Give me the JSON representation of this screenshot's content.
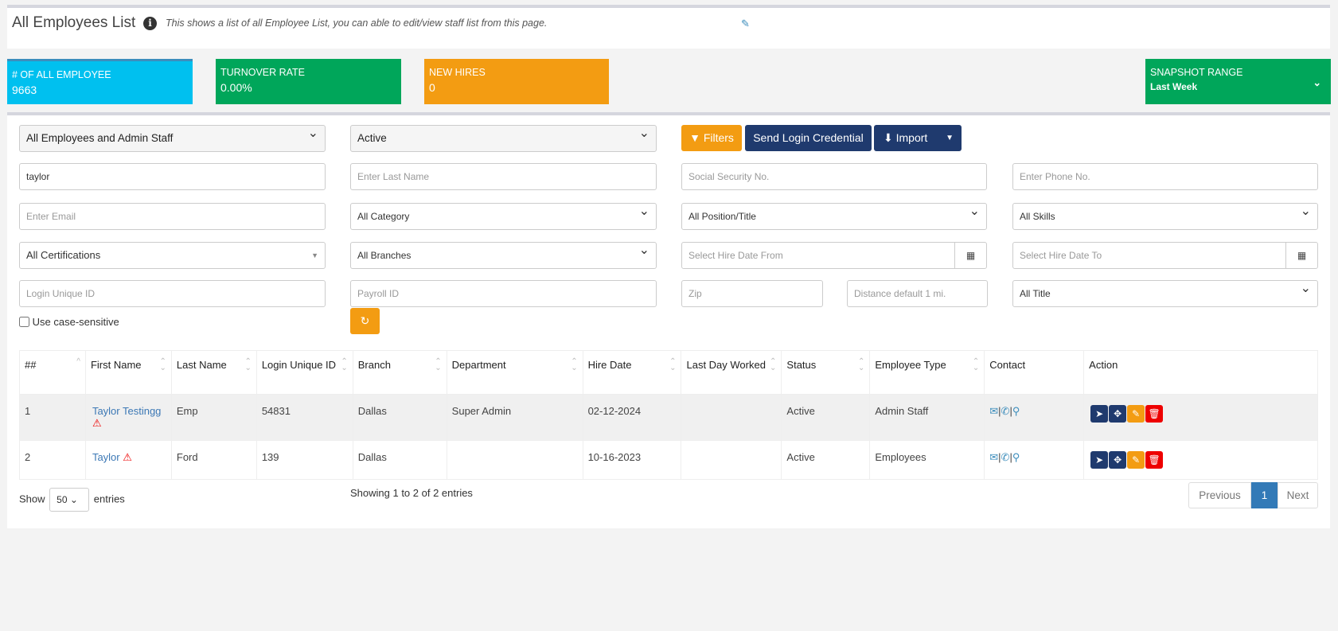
{
  "header": {
    "title": "All Employees List",
    "description": "This shows a list of all Employee List, you can able to edit/view staff list from this page."
  },
  "stats": [
    {
      "label": "# OF ALL EMPLOYEE",
      "value": "9663",
      "color": "#00c0ef"
    },
    {
      "label": "TURNOVER RATE",
      "value": "0.00%",
      "color": "#00a65a"
    },
    {
      "label": "NEW HIRES",
      "value": "0",
      "color": "#f39c12"
    }
  ],
  "snapshot": {
    "label": "SNAPSHOT RANGE",
    "value": "Last Week"
  },
  "filters": {
    "employee_group": "All Employees and Admin Staff",
    "status": "Active",
    "filters_btn": "Filters",
    "send_login_btn": "Send Login Credential",
    "import_btn": "Import",
    "first_name": "taylor",
    "last_name_ph": "Enter Last Name",
    "ssn_ph": "Social Security No.",
    "phone_ph": "Enter Phone No.",
    "email_ph": "Enter Email",
    "category": "All Category",
    "position": "All Position/Title",
    "skills": "All Skills",
    "certifications": "All Certifications",
    "branches": "All Branches",
    "hire_from_ph": "Select Hire Date From",
    "hire_to_ph": "Select Hire Date To",
    "login_id_ph": "Login Unique ID",
    "payroll_ph": "Payroll ID",
    "zip_ph": "Zip",
    "distance_ph": "Distance default 1 mi.",
    "title": "All Title",
    "case_sensitive": "Use case-sensitive"
  },
  "table": {
    "columns": [
      "##",
      "First Name",
      "Last Name",
      "Login Unique ID",
      "Branch",
      "Department",
      "Hire Date",
      "Last Day Worked",
      "Status",
      "Employee Type",
      "Contact",
      "Action"
    ],
    "rows": [
      {
        "n": "1",
        "first": "Taylor Testingg",
        "last": "Emp",
        "login": "54831",
        "branch": "Dallas",
        "dept": "Super Admin",
        "hire": "02-12-2024",
        "lastday": "",
        "status": "Active",
        "type": "Admin Staff"
      },
      {
        "n": "2",
        "first": "Taylor",
        "last": "Ford",
        "login": "139",
        "branch": "Dallas",
        "dept": "",
        "hire": "10-16-2023",
        "lastday": "",
        "status": "Active",
        "type": "Employees"
      }
    ]
  },
  "footer": {
    "show": "Show",
    "page_size": "50",
    "entries": "entries",
    "info": "Showing 1 to 2 of 2 entries",
    "prev": "Previous",
    "page": "1",
    "next": "Next"
  }
}
